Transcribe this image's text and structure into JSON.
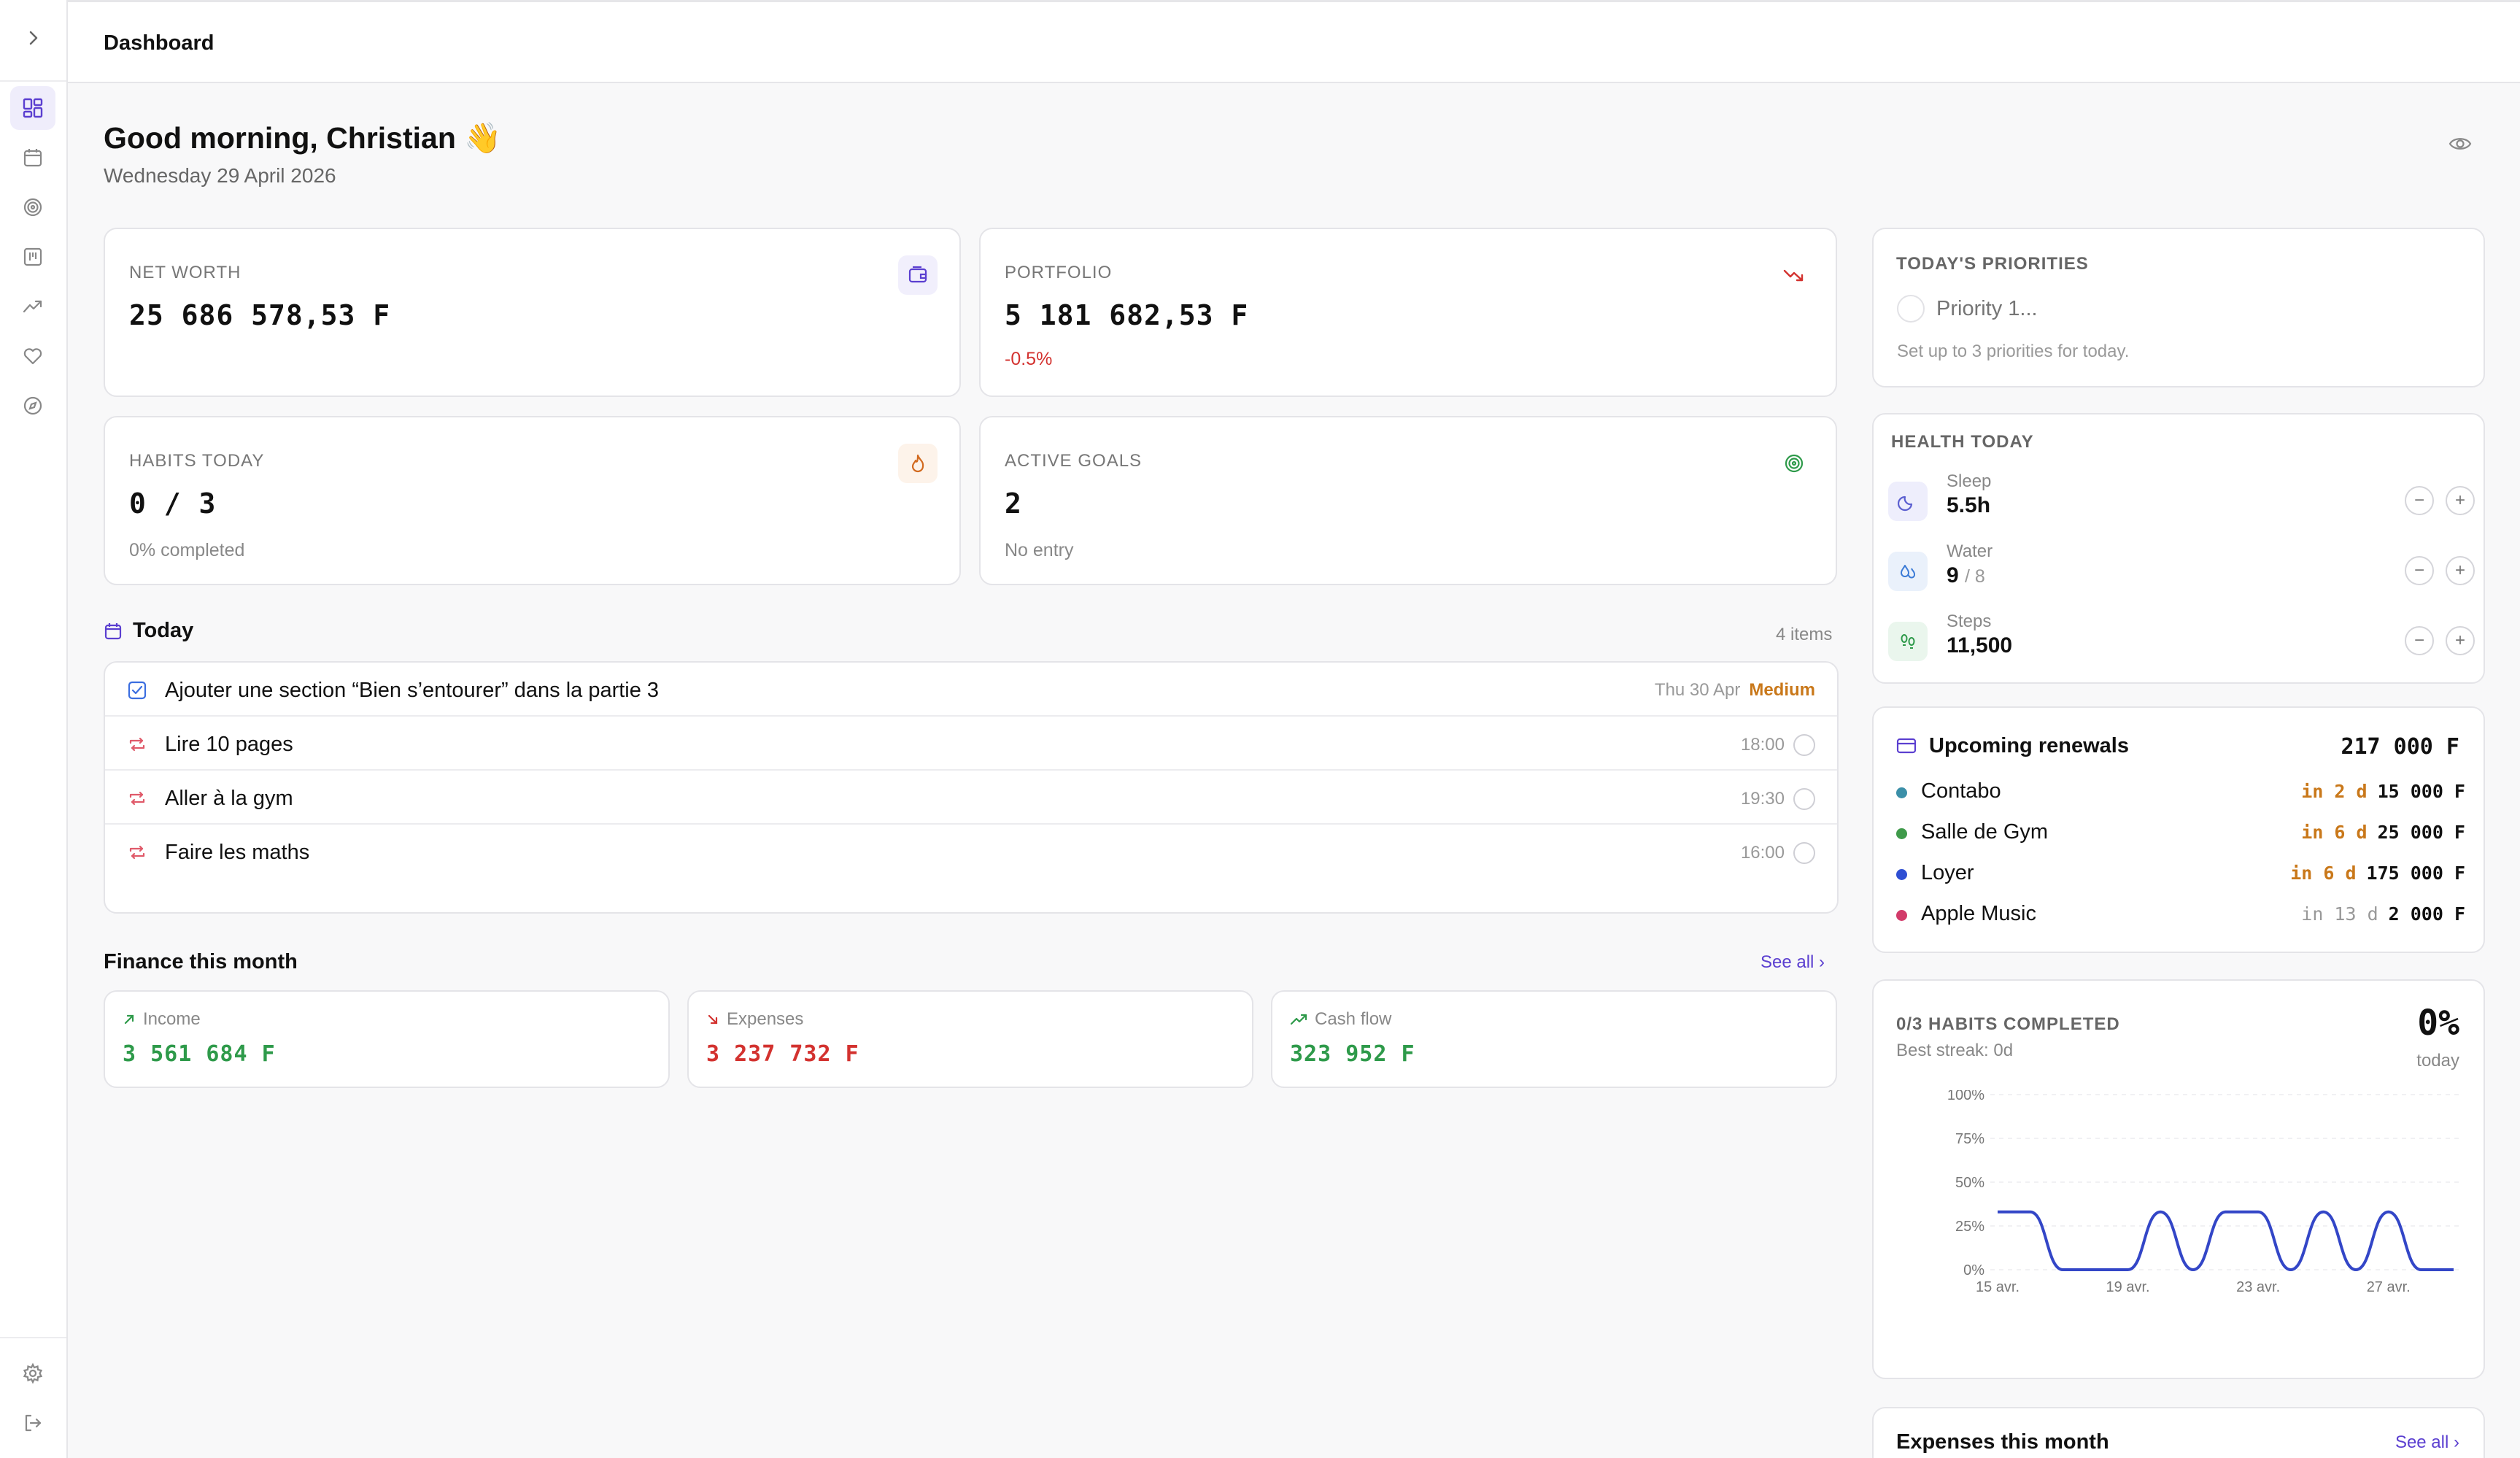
{
  "header": {
    "title": "Dashboard"
  },
  "greeting": {
    "text": "Good morning, Christian 👋",
    "date": "Wednesday 29 April 2026"
  },
  "stats": {
    "net_worth": {
      "label": "NET WORTH",
      "value": "25 686 578,53 F"
    },
    "portfolio": {
      "label": "PORTFOLIO",
      "value": "5 181 682,53 F",
      "change": "-0.5%"
    },
    "habits": {
      "label": "HABITS TODAY",
      "value": "0 / 3",
      "sub": "0% completed"
    },
    "goals": {
      "label": "ACTIVE GOALS",
      "value": "2",
      "sub": "No entry"
    }
  },
  "today": {
    "title": "Today",
    "count": "4 items",
    "tasks": [
      {
        "text": "Ajouter une section “Bien s’entourer” dans la partie 3",
        "date": "Thu 30 Apr",
        "priority": "Medium"
      },
      {
        "text": "Lire 10 pages",
        "time": "18:00"
      },
      {
        "text": "Aller à la gym",
        "time": "19:30"
      },
      {
        "text": "Faire les maths",
        "time": "16:00"
      }
    ]
  },
  "finance": {
    "title": "Finance this month",
    "see_all": "See all",
    "income": {
      "label": "Income",
      "value": "3 561 684 F"
    },
    "expenses": {
      "label": "Expenses",
      "value": "3 237 732 F"
    },
    "cashflow": {
      "label": "Cash flow",
      "value": "323 952 F"
    }
  },
  "priorities": {
    "title": "TODAY'S PRIORITIES",
    "placeholder": "Priority 1...",
    "hint": "Set up to 3 priorities for today."
  },
  "health": {
    "title": "HEALTH TODAY",
    "sleep": {
      "label": "Sleep",
      "value": "5.5h"
    },
    "water": {
      "label": "Water",
      "value": "9",
      "unit": "/ 8"
    },
    "steps": {
      "label": "Steps",
      "value": "11,500"
    },
    "minus": "−",
    "plus": "+"
  },
  "renewals": {
    "title": "Upcoming renewals",
    "total": "217 000 F",
    "items": [
      {
        "name": "Contabo",
        "days": "in 2 d",
        "amount": "15 000 F",
        "color": "#3b8fa8"
      },
      {
        "name": "Salle de Gym",
        "days": "in 6 d",
        "amount": "25 000 F",
        "color": "#3f9a4a"
      },
      {
        "name": "Loyer",
        "days": "in 6 d",
        "amount": "175 000 F",
        "color": "#2f4fd3"
      },
      {
        "name": "Apple Music",
        "days": "in 13 d",
        "amount": "2 000 F",
        "color": "#d23b6a"
      }
    ]
  },
  "habits_chart": {
    "title": "0/3 HABITS COMPLETED",
    "streak": "Best streak: 0d",
    "percent": "0%",
    "percent_label": "today"
  },
  "chart_data": {
    "type": "line",
    "x": [
      "15 avr.",
      "16 avr.",
      "17 avr.",
      "18 avr.",
      "19 avr.",
      "20 avr.",
      "21 avr.",
      "22 avr.",
      "23 avr.",
      "24 avr.",
      "25 avr.",
      "26 avr.",
      "27 avr.",
      "28 avr.",
      "29 avr."
    ],
    "x_tick_labels": [
      "15 avr.",
      "19 avr.",
      "23 avr.",
      "27 avr."
    ],
    "series": [
      {
        "values": [
          33,
          33,
          0,
          0,
          0,
          33,
          0,
          33,
          33,
          0,
          33,
          0,
          33,
          0,
          0
        ],
        "color": "#3346c7"
      }
    ],
    "y_tick_labels": [
      "100%",
      "75%",
      "50%",
      "25%",
      "0%"
    ],
    "ylim": [
      0,
      100
    ],
    "grid": true
  },
  "expenses_month": {
    "title": "Expenses this month",
    "see_all": "See all"
  },
  "colors": {
    "accent": "#5b3fd0",
    "positive": "#2e9a4a",
    "negative": "#d3322f",
    "warning": "#c9781a"
  },
  "sidebar": {
    "items": [
      "dashboard-icon",
      "calendar-icon",
      "target-icon",
      "board-icon",
      "trending-icon",
      "heart-icon",
      "compass-icon"
    ],
    "bottom": [
      "settings-icon",
      "logout-icon"
    ]
  }
}
